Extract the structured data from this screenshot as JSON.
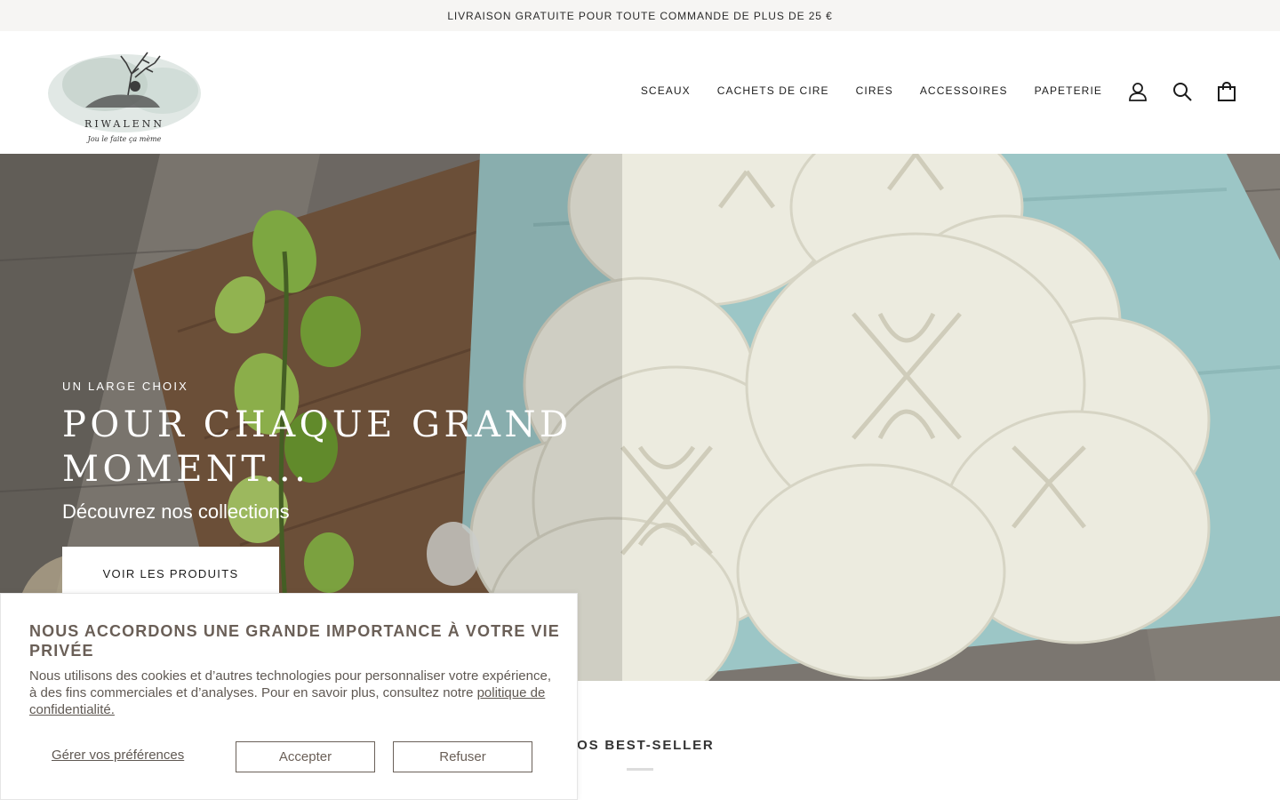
{
  "announcement": {
    "text": "LIVRAISON GRATUITE POUR TOUTE COMMANDE DE PLUS DE 25 €"
  },
  "header": {
    "logo": {
      "name": "RIWALENN",
      "tagline": "Jou le faite ça mème"
    },
    "nav": [
      "SCEAUX",
      "CACHETS DE CIRE",
      "CIRES",
      "ACCESSOIRES",
      "PAPETERIE"
    ],
    "icons": [
      "account-icon",
      "search-icon",
      "cart-icon"
    ]
  },
  "hero": {
    "kicker": "UN LARGE CHOIX",
    "title": "POUR CHAQUE GRAND MOMENT...",
    "subtitle": "Découvrez nos collections",
    "button": "VOIR LES PRODUITS"
  },
  "section": {
    "title": "NOS BEST-SELLER"
  },
  "cookie": {
    "title": "NOUS ACCORDONS UNE GRANDE IMPORTANCE À VOTRE VIE PRIVÉE",
    "body": "Nous utilisons des cookies et d’autres technologies pour personnaliser votre expérience, à des fins commerciales et d’analyses. Pour en savoir plus, consultez notre ",
    "link": "politique de confidentialité.",
    "manage": "Gérer vos préférences",
    "accept": "Accepter",
    "refuse": "Refuser"
  }
}
